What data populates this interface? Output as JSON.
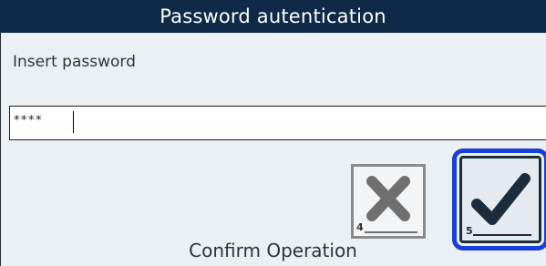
{
  "dialog": {
    "title": "Password autentication",
    "prompt": "Insert password",
    "password_value": "****",
    "cancel_key": "4",
    "confirm_key": "5",
    "caption": "Confirm Operation"
  },
  "icons": {
    "cancel": "close-icon",
    "confirm": "checkmark-icon"
  },
  "colors": {
    "titlebar": "#0e2a48",
    "dialog_background": "#eaf0f4",
    "focus_outline": "#1a3fd6",
    "cancel_icon": "#6f6f6f",
    "confirm_icon": "#1d2c3a"
  }
}
